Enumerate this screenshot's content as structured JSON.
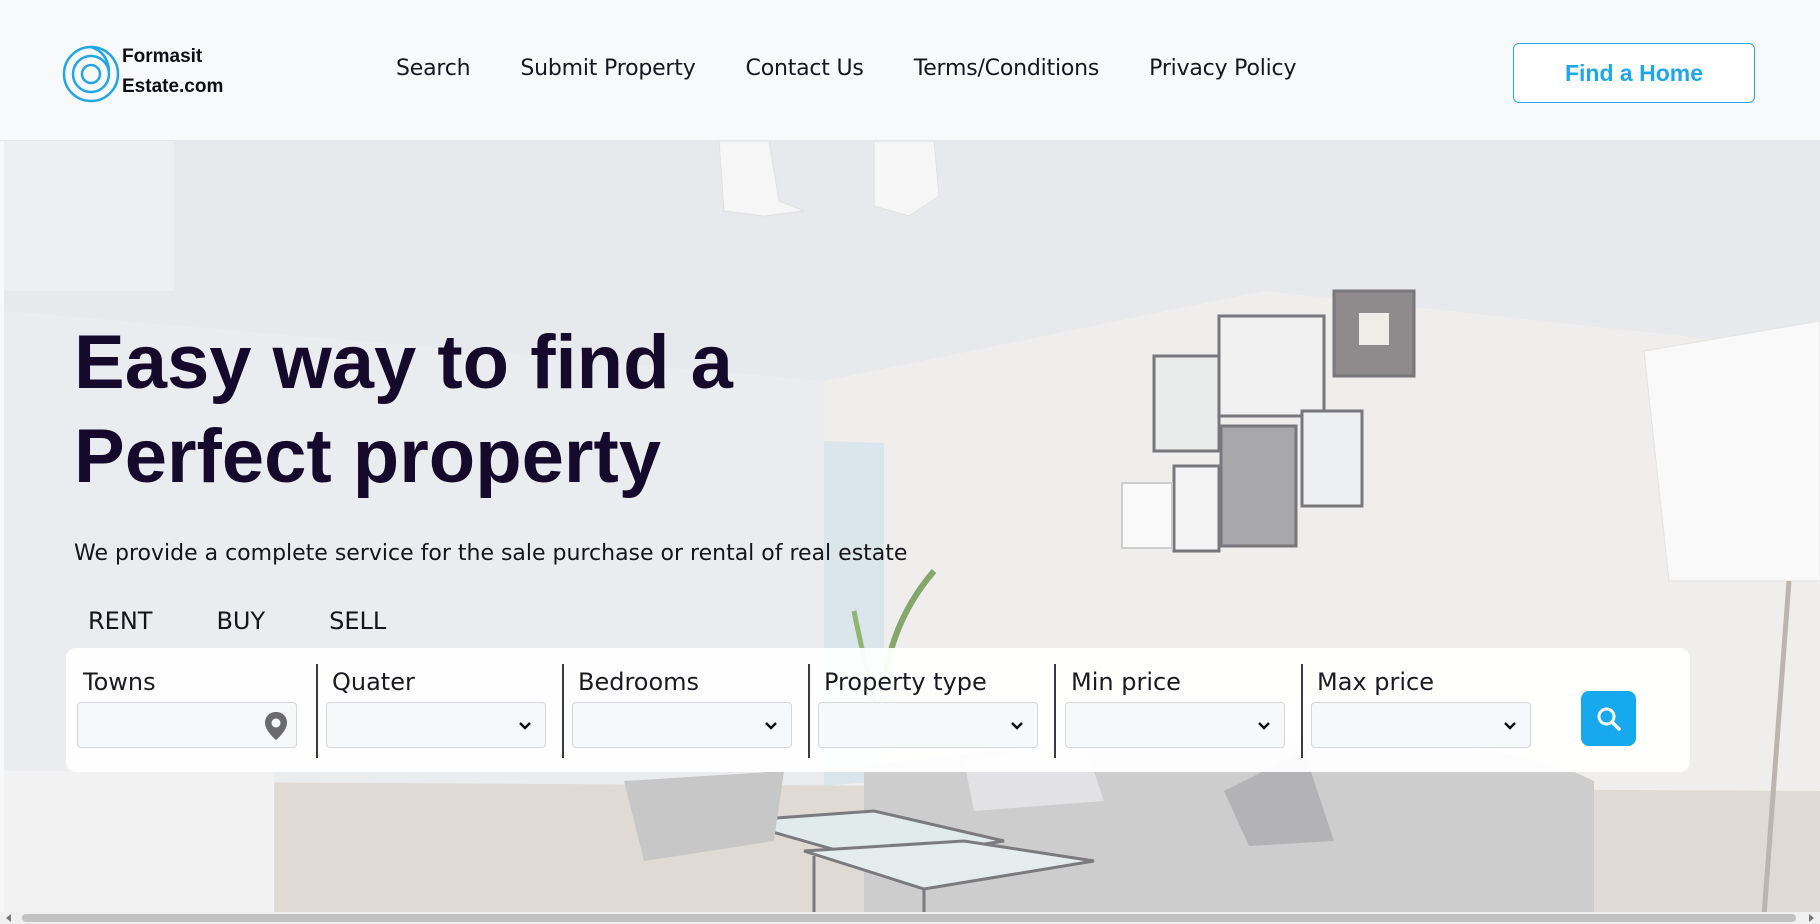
{
  "header": {
    "logo_line1": "Formasit",
    "logo_line2": "Estate.com",
    "nav": [
      "Search",
      "Submit Property",
      "Contact Us",
      "Terms/Conditions",
      "Privacy Policy"
    ],
    "cta_label": "Find a Home"
  },
  "hero": {
    "headline_line1": "Easy way to find a",
    "headline_line2": "Perfect property",
    "subtitle": "We provide a complete service for the sale purchase or rental of real estate",
    "tabs": [
      "RENT",
      "BUY",
      "SELL"
    ]
  },
  "search": {
    "fields": [
      {
        "label": "Towns",
        "value": "",
        "control": "text-with-pin"
      },
      {
        "label": "Quater",
        "value": "",
        "control": "select"
      },
      {
        "label": "Bedrooms",
        "value": "",
        "control": "select"
      },
      {
        "label": "Property type",
        "value": "",
        "control": "select"
      },
      {
        "label": "Min price",
        "value": "",
        "control": "select"
      },
      {
        "label": "Max price",
        "value": "",
        "control": "select"
      }
    ]
  },
  "colors": {
    "accent": "#1ea8ea",
    "headline": "#160a2c",
    "header_bg": "#f8f9fb"
  },
  "icons": {
    "logo": "spiral-logo-icon",
    "town_pin": "map-pin-icon",
    "select_arrow": "chevron-down-icon",
    "search_button": "search-icon"
  }
}
